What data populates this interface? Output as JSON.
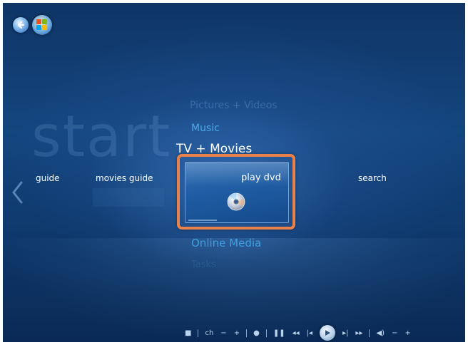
{
  "app": {
    "watermark_text": "start"
  },
  "top_controls": {
    "back_icon": "back-arrow-icon",
    "start_icon": "windows-flag-icon"
  },
  "menu": {
    "items": [
      {
        "label": "Pictures + Videos",
        "state": "faded"
      },
      {
        "label": "Music",
        "state": "normal"
      },
      {
        "label": "TV + Movies",
        "state": "selected"
      },
      {
        "label": "Online Media",
        "state": "normal"
      },
      {
        "label": "Tasks",
        "state": "faded"
      }
    ]
  },
  "strip": {
    "items": [
      "guide",
      "movies guide",
      "play dvd",
      "search"
    ],
    "focused_index": 2,
    "focused_tile": {
      "label": "play dvd",
      "icon": "dvd-disc-icon",
      "highlight_color": "#e9824a"
    }
  },
  "transport": {
    "controls": [
      {
        "name": "stop",
        "glyph": "■"
      },
      {
        "name": "ch",
        "glyph": "ch"
      },
      {
        "name": "ch-minus",
        "glyph": "−"
      },
      {
        "name": "ch-plus",
        "glyph": "+"
      },
      {
        "name": "record",
        "glyph": "●"
      },
      {
        "name": "pause",
        "glyph": "❚❚"
      },
      {
        "name": "rewind",
        "glyph": "◂◂"
      },
      {
        "name": "skip-back",
        "glyph": "|◂"
      },
      {
        "name": "play",
        "glyph": "▶"
      },
      {
        "name": "skip-forward",
        "glyph": "▸|"
      },
      {
        "name": "fast-forward",
        "glyph": "▸▸"
      },
      {
        "name": "mute",
        "glyph": "◀)"
      },
      {
        "name": "vol-minus",
        "glyph": "−"
      },
      {
        "name": "vol-plus",
        "glyph": "+"
      }
    ]
  },
  "colors": {
    "background_top": "#0f3566",
    "background_bottom": "#0a2a55",
    "accent_blue": "#4fa8e8",
    "selection_orange": "#e9824a"
  }
}
